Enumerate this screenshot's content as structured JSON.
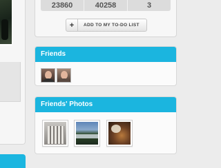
{
  "stats": {
    "values": [
      "23860",
      "40258",
      "3"
    ]
  },
  "todo": {
    "plus": "+",
    "label": "ADD TO MY TO-DO LIST"
  },
  "friends": {
    "title": "Friends"
  },
  "friends_photos": {
    "title": "Friends' Photos"
  },
  "colors": {
    "accent": "#1bb5df",
    "panel": "#fbfbfb",
    "background": "#ececec"
  }
}
